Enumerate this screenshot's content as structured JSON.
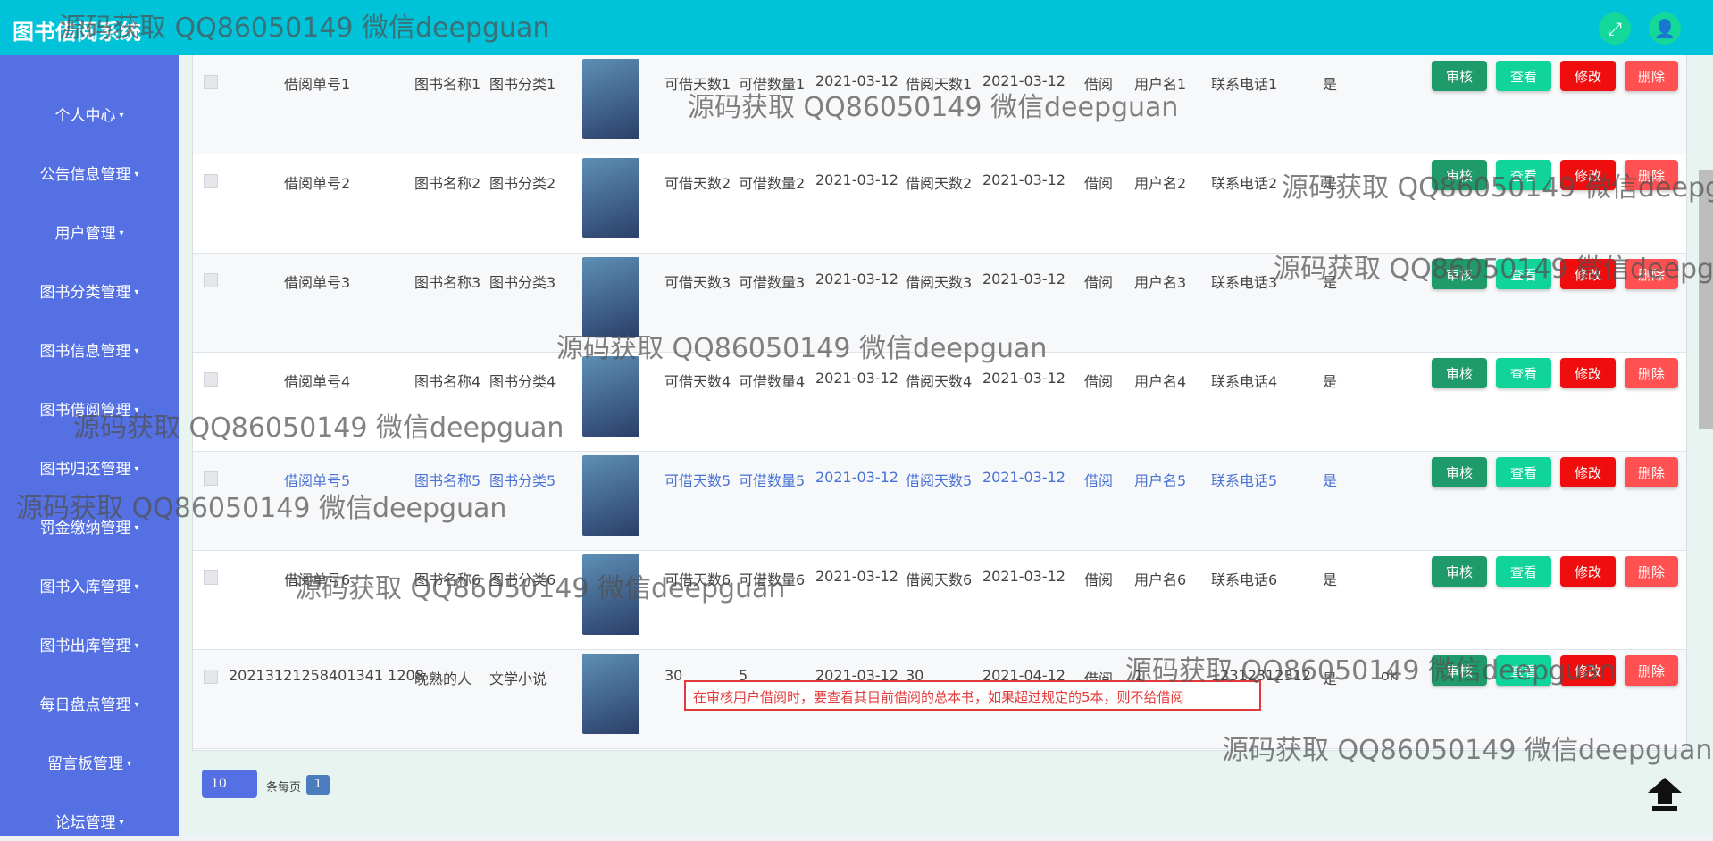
{
  "app": {
    "title": "图书借阅系统"
  },
  "header": {
    "fullscreen_icon": "fullscreen-icon",
    "user_icon": "user-icon"
  },
  "sidebar": {
    "items": [
      {
        "label": "个人中心"
      },
      {
        "label": "公告信息管理"
      },
      {
        "label": "用户管理"
      },
      {
        "label": "图书分类管理"
      },
      {
        "label": "图书信息管理"
      },
      {
        "label": "图书借阅管理"
      },
      {
        "label": "图书归还管理"
      },
      {
        "label": "罚金缴纳管理"
      },
      {
        "label": "图书入库管理"
      },
      {
        "label": "图书出库管理"
      },
      {
        "label": "每日盘点管理"
      },
      {
        "label": "留言板管理"
      },
      {
        "label": "论坛管理"
      }
    ]
  },
  "actions": {
    "audit": "审核",
    "view": "查看",
    "edit": "修改",
    "delete": "删除"
  },
  "rows": [
    {
      "id": "借阅单号1",
      "name": "图书名称1",
      "category": "图书分类1",
      "days_allowed": "可借天数1",
      "qty_allowed": "可借数量1",
      "date1": "2021-03-12",
      "borrow_days": "借阅天数1",
      "date2": "2021-03-12",
      "status": "借阅",
      "user": "用户名1",
      "phone": "联系电话1",
      "approved": "是",
      "reply": ""
    },
    {
      "id": "借阅单号2",
      "name": "图书名称2",
      "category": "图书分类2",
      "days_allowed": "可借天数2",
      "qty_allowed": "可借数量2",
      "date1": "2021-03-12",
      "borrow_days": "借阅天数2",
      "date2": "2021-03-12",
      "status": "借阅",
      "user": "用户名2",
      "phone": "联系电话2",
      "approved": "是",
      "reply": ""
    },
    {
      "id": "借阅单号3",
      "name": "图书名称3",
      "category": "图书分类3",
      "days_allowed": "可借天数3",
      "qty_allowed": "可借数量3",
      "date1": "2021-03-12",
      "borrow_days": "借阅天数3",
      "date2": "2021-03-12",
      "status": "借阅",
      "user": "用户名3",
      "phone": "联系电话3",
      "approved": "是",
      "reply": ""
    },
    {
      "id": "借阅单号4",
      "name": "图书名称4",
      "category": "图书分类4",
      "days_allowed": "可借天数4",
      "qty_allowed": "可借数量4",
      "date1": "2021-03-12",
      "borrow_days": "借阅天数4",
      "date2": "2021-03-12",
      "status": "借阅",
      "user": "用户名4",
      "phone": "联系电话4",
      "approved": "是",
      "reply": ""
    },
    {
      "id": "借阅单号5",
      "name": "图书名称5",
      "category": "图书分类5",
      "days_allowed": "可借天数5",
      "qty_allowed": "可借数量5",
      "date1": "2021-03-12",
      "borrow_days": "借阅天数5",
      "date2": "2021-03-12",
      "status": "借阅",
      "user": "用户名5",
      "phone": "联系电话5",
      "approved": "是",
      "reply": ""
    },
    {
      "id": "借阅单号6",
      "name": "图书名称6",
      "category": "图书分类6",
      "days_allowed": "可借天数6",
      "qty_allowed": "可借数量6",
      "date1": "2021-03-12",
      "borrow_days": "借阅天数6",
      "date2": "2021-03-12",
      "status": "借阅",
      "user": "用户名6",
      "phone": "联系电话6",
      "approved": "是",
      "reply": ""
    },
    {
      "id": "20213121258401341 1208",
      "name": "晚熟的人",
      "category": "文学小说",
      "days_allowed": "30",
      "qty_allowed": "5",
      "date1": "2021-03-12",
      "borrow_days": "30",
      "date2": "2021-04-12",
      "status": "借阅",
      "user": "1",
      "phone": "12312312312",
      "approved": "是",
      "reply": "ok"
    }
  ],
  "annotation": {
    "text": "在审核用户借阅时，要查看其目前借阅的总本书，如果超过规定的5本，则不给借阅"
  },
  "pagination": {
    "page_size": "10",
    "per_page_label": "条每页",
    "current_page": "1"
  },
  "watermark": "源码获取 QQ86050149 微信deepguan",
  "colors": {
    "header": "#00c3d9",
    "sidebar": "#5470e3",
    "audit": "#1f9a6a",
    "view": "#10d49a",
    "edit": "#f00d0d",
    "delete": "#ff5151"
  }
}
